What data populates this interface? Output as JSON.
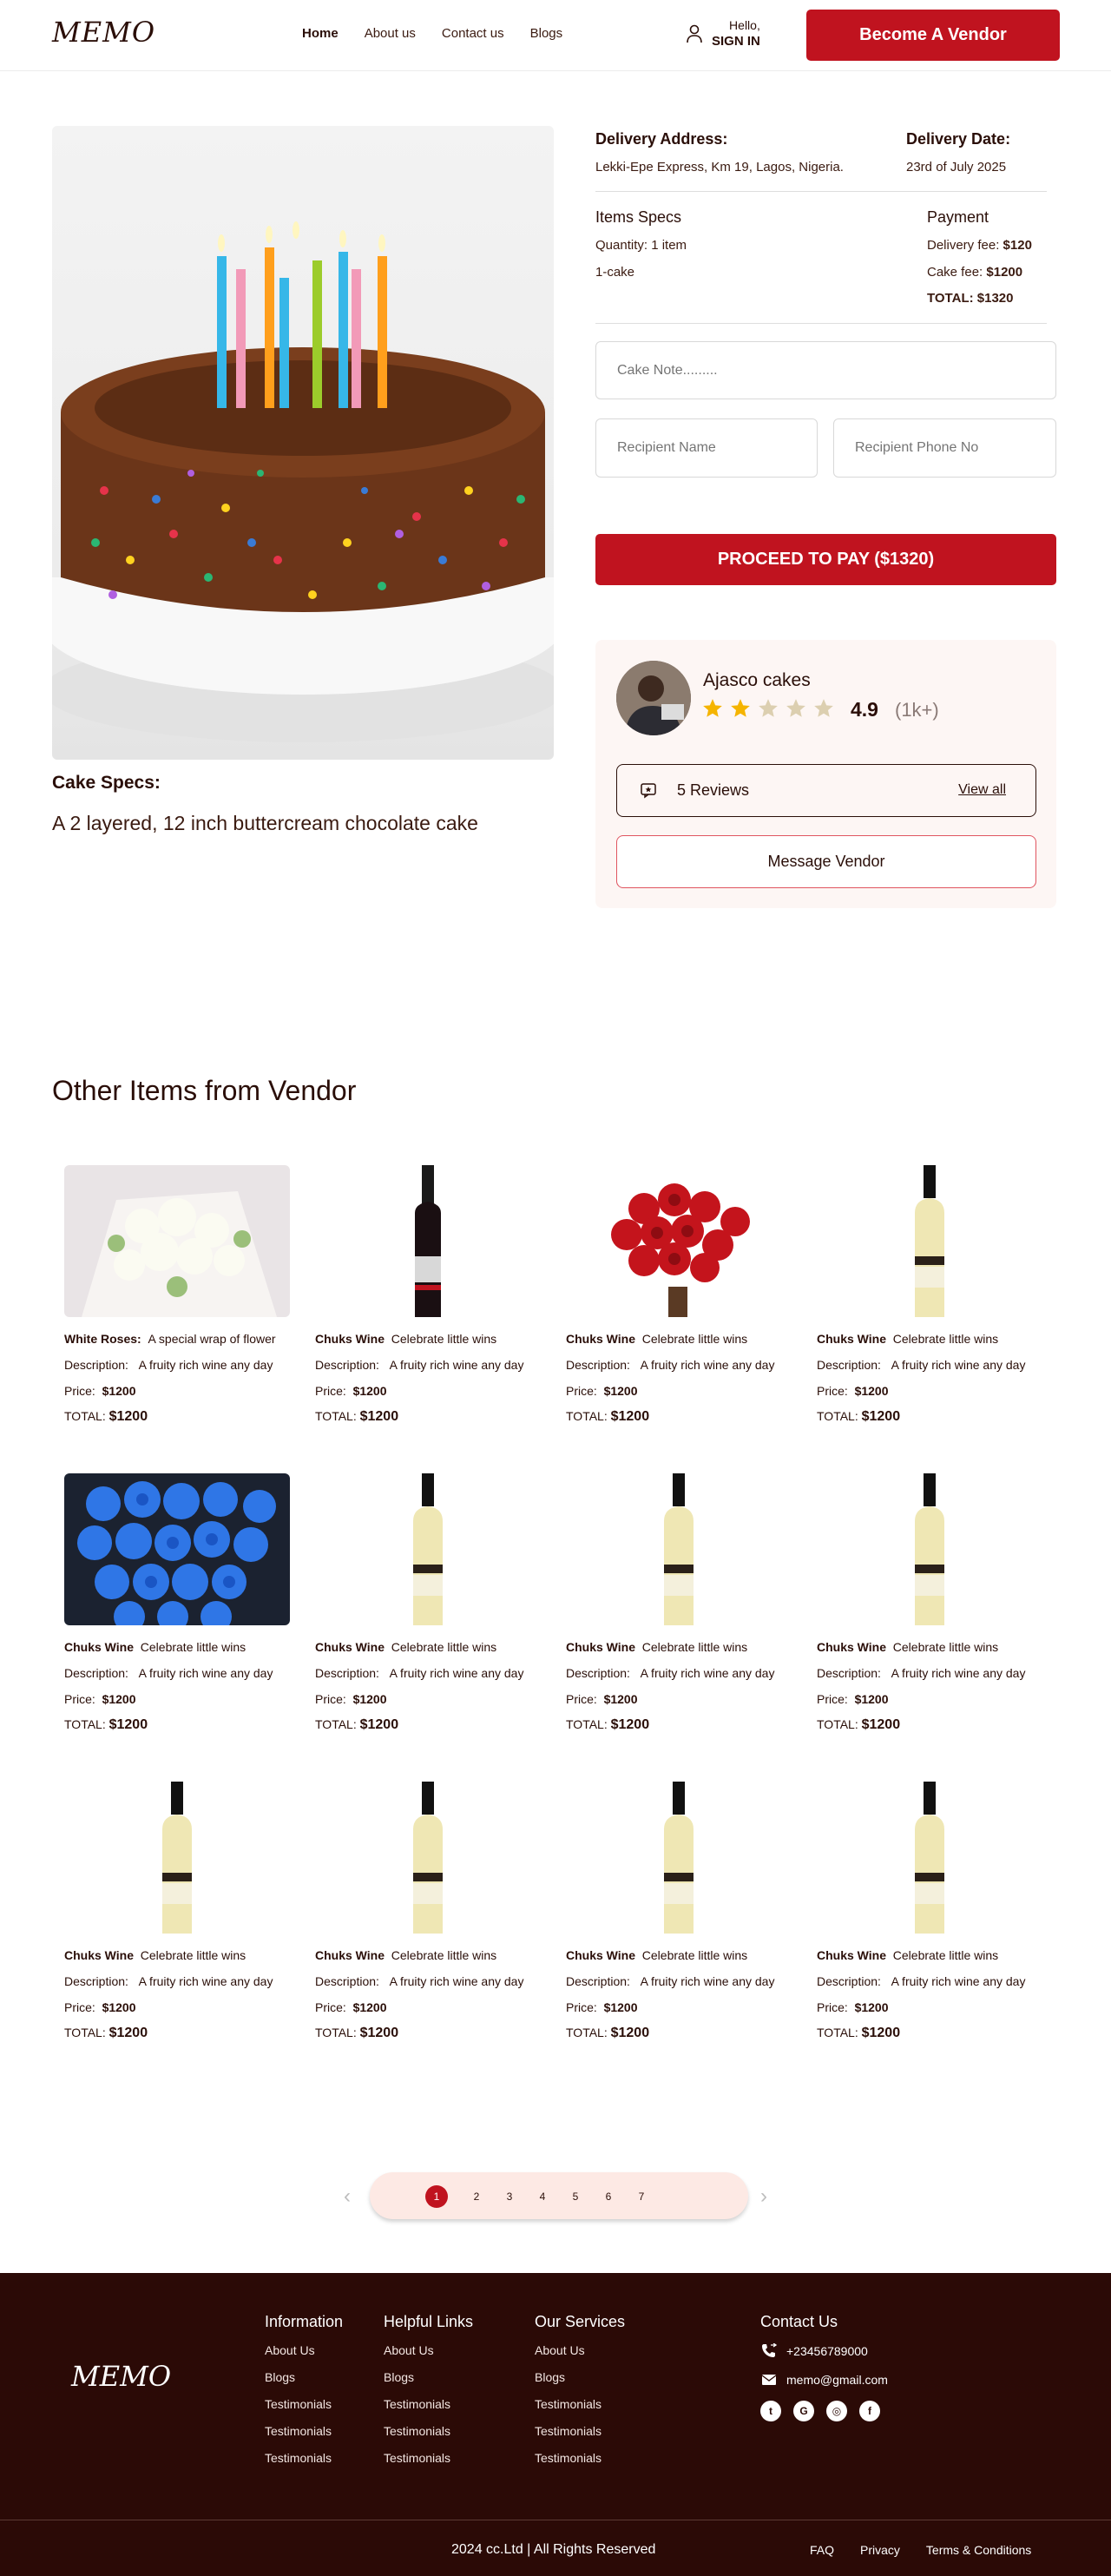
{
  "header": {
    "logo": "MEMO",
    "nav": [
      "Home",
      "About us",
      "Contact us",
      "Blogs"
    ],
    "hello": "Hello,",
    "signin": "SIGN IN",
    "vendor_button": "Become A Vendor"
  },
  "order": {
    "delivery_address_label": "Delivery Address:",
    "delivery_address": "Lekki-Epe Express, Km 19, Lagos, Nigeria.",
    "delivery_date_label": "Delivery Date:",
    "delivery_date": "23rd of July 2025",
    "items_specs_label": "Items Specs",
    "quantity": "Quantity: 1 item",
    "item": "1-cake",
    "payment_label": "Payment",
    "delivery_fee_label": "Delivery fee:",
    "delivery_fee": "$120",
    "cake_fee_label": "Cake fee:",
    "cake_fee": "$1200",
    "total_label": "TOTAL:",
    "total": "$1320",
    "cake_note_placeholder": "Cake Note.........",
    "recipient_name_placeholder": "Recipient Name",
    "recipient_phone_placeholder": "Recipient Phone No",
    "pay_button": "PROCEED TO PAY ($1320)"
  },
  "product": {
    "specs_title": "Cake Specs:",
    "specs_text": "A 2 layered, 12 inch buttercream chocolate cake"
  },
  "vendor": {
    "name": "Ajasco cakes",
    "rating": "4.9",
    "rating_count": "(1k+)",
    "stars_filled": 2,
    "stars_total": 5,
    "reviews_label": "5 Reviews",
    "view_all": "View all",
    "message_button": "Message Vendor"
  },
  "other_items": {
    "title": "Other Items from Vendor",
    "description_label": "Description:",
    "price_label": "Price:",
    "total_label": "TOTAL:",
    "items": [
      {
        "name": "White Roses:",
        "tagline": "A special wrap of flower",
        "description": "A fruity rich wine any day",
        "price": "$1200",
        "total": "$1200",
        "image": "white-roses"
      },
      {
        "name": "Chuks Wine",
        "tagline": "Celebrate little wins",
        "description": "A fruity rich wine any day",
        "price": "$1200",
        "total": "$1200",
        "image": "red-wine-bottle"
      },
      {
        "name": "Chuks Wine",
        "tagline": "Celebrate little wins",
        "description": "A fruity rich wine any day",
        "price": "$1200",
        "total": "$1200",
        "image": "red-roses"
      },
      {
        "name": "Chuks Wine",
        "tagline": "Celebrate little wins",
        "description": "A fruity rich wine any day",
        "price": "$1200",
        "total": "$1200",
        "image": "white-wine-bottle"
      },
      {
        "name": "Chuks Wine",
        "tagline": "Celebrate little wins",
        "description": "A fruity rich wine any day",
        "price": "$1200",
        "total": "$1200",
        "image": "blue-roses"
      },
      {
        "name": "Chuks Wine",
        "tagline": "Celebrate little wins",
        "description": "A fruity rich wine any day",
        "price": "$1200",
        "total": "$1200",
        "image": "white-wine-bottle"
      },
      {
        "name": "Chuks Wine",
        "tagline": "Celebrate little wins",
        "description": "A fruity rich wine any day",
        "price": "$1200",
        "total": "$1200",
        "image": "white-wine-bottle"
      },
      {
        "name": "Chuks Wine",
        "tagline": "Celebrate little wins",
        "description": "A fruity rich wine any day",
        "price": "$1200",
        "total": "$1200",
        "image": "white-wine-bottle"
      },
      {
        "name": "Chuks Wine",
        "tagline": "Celebrate little wins",
        "description": "A fruity rich wine any day",
        "price": "$1200",
        "total": "$1200",
        "image": "white-wine-bottle"
      },
      {
        "name": "Chuks Wine",
        "tagline": "Celebrate little wins",
        "description": "A fruity rich wine any day",
        "price": "$1200",
        "total": "$1200",
        "image": "white-wine-bottle"
      },
      {
        "name": "Chuks Wine",
        "tagline": "Celebrate little wins",
        "description": "A fruity rich wine any day",
        "price": "$1200",
        "total": "$1200",
        "image": "white-wine-bottle"
      },
      {
        "name": "Chuks Wine",
        "tagline": "Celebrate little wins",
        "description": "A fruity rich wine any day",
        "price": "$1200",
        "total": "$1200",
        "image": "white-wine-bottle"
      }
    ]
  },
  "pagination": {
    "pages": [
      "1",
      "2",
      "3",
      "4",
      "5",
      "6",
      "7"
    ],
    "active": "1"
  },
  "footer": {
    "logo": "MEMO",
    "columns": [
      {
        "heading": "Information",
        "items": [
          "About Us",
          "Blogs",
          "Testimonials",
          "Testimonials",
          "Testimonials"
        ]
      },
      {
        "heading": "Helpful Links",
        "items": [
          "About Us",
          "Blogs",
          "Testimonials",
          "Testimonials",
          "Testimonials"
        ]
      },
      {
        "heading": "Our Services",
        "items": [
          "About Us",
          "Blogs",
          "Testimonials",
          "Testimonials",
          "Testimonials"
        ]
      }
    ],
    "contact_heading": "Contact Us",
    "phone": "+23456789000",
    "email": "memo@gmail.com",
    "socials": [
      "twitter-icon",
      "google-icon",
      "dribbble-icon",
      "facebook-icon"
    ],
    "copyright": "2024 cc.Ltd | All Rights Reserved",
    "links": [
      "FAQ",
      "Privacy",
      "Terms & Conditions"
    ]
  },
  "colors": {
    "brand_red": "#c0131f",
    "dark_brown": "#2b0a06",
    "star_gold": "#f5b400"
  }
}
